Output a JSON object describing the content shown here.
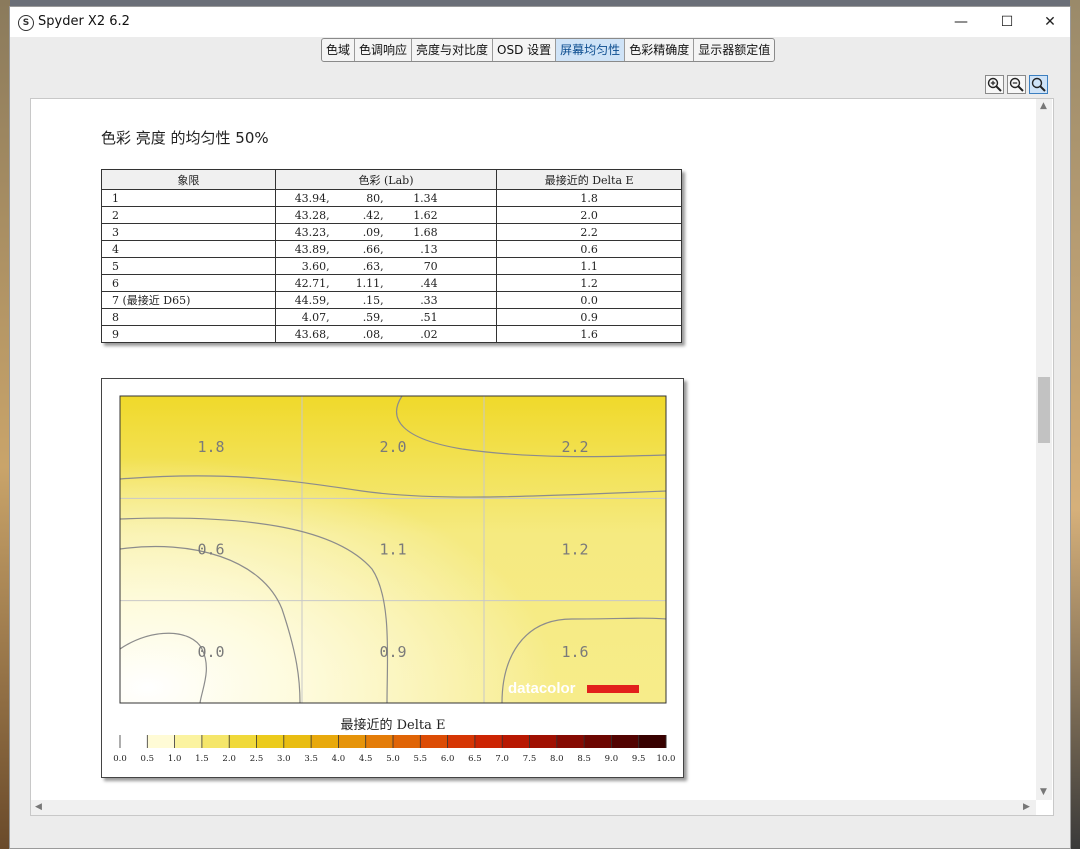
{
  "window": {
    "title": "Spyder X2 6.2",
    "controls": [
      "—",
      "☐",
      "✕"
    ]
  },
  "tabs": [
    {
      "label": "色域"
    },
    {
      "label": "色调响应"
    },
    {
      "label": "亮度与对比度"
    },
    {
      "label": "OSD 设置"
    },
    {
      "label": "屏幕均匀性",
      "active": true
    },
    {
      "label": "色彩精确度"
    },
    {
      "label": "显示器额定值"
    }
  ],
  "zoom_tools": [
    "zoom-in-icon",
    "zoom-out-icon",
    "zoom-fit-icon"
  ],
  "report": {
    "title": "色彩 亮度 的均匀性 50%",
    "table": {
      "headers": [
        "象限",
        "色彩 (Lab)",
        "最接近的 Delta E"
      ],
      "rows": [
        {
          "q": "1",
          "l": "43.94,",
          "a": "80,",
          "b": "1.34",
          "de": "1.8"
        },
        {
          "q": "2",
          "l": "43.28,",
          "a": ".42,",
          "b": "1.62",
          "de": "2.0"
        },
        {
          "q": "3",
          "l": "43.23,",
          "a": ".09,",
          "b": "1.68",
          "de": "2.2"
        },
        {
          "q": "4",
          "l": "43.89,",
          "a": ".66,",
          "b": ".13",
          "de": "0.6"
        },
        {
          "q": "5",
          "l": "3.60,",
          "a": ".63,",
          "b": "70",
          "de": "1.1"
        },
        {
          "q": "6",
          "l": "42.71,",
          "a": "1.11,",
          "b": ".44",
          "de": "1.2"
        },
        {
          "q": "7 (最接近 D65)",
          "l": "44.59,",
          "a": ".15,",
          "b": ".33",
          "de": "0.0"
        },
        {
          "q": "8",
          "l": "4.07,",
          "a": ".59,",
          "b": ".51",
          "de": "0.9"
        },
        {
          "q": "9",
          "l": "43.68,",
          "a": ".08,",
          "b": ".02",
          "de": "1.6"
        }
      ]
    }
  },
  "chart_data": {
    "type": "heatmap",
    "grid": {
      "rows": 3,
      "cols": 3
    },
    "values": [
      [
        1.8,
        2.0,
        2.2
      ],
      [
        0.6,
        1.1,
        1.2
      ],
      [
        0.0,
        0.9,
        1.6
      ]
    ],
    "cell_labels": [
      [
        "1.8",
        "2.0",
        "2.2"
      ],
      [
        "0.6",
        "1.1",
        "1.2"
      ],
      [
        "0.0",
        "0.9",
        "1.6"
      ]
    ],
    "watermark": "datacolor",
    "colorbar": {
      "title": "最接近的 Delta E",
      "ticks": [
        "0.0",
        "0.5",
        "1.0",
        "1.5",
        "2.0",
        "2.5",
        "3.0",
        "3.5",
        "4.0",
        "4.5",
        "5.0",
        "5.5",
        "6.0",
        "6.5",
        "7.0",
        "7.5",
        "8.0",
        "8.5",
        "9.0",
        "9.5",
        "10.0"
      ],
      "colors": [
        "#ffffff",
        "#fffbd6",
        "#fbf3a0",
        "#f5e66a",
        "#f0d93a",
        "#eccb1c",
        "#e9bd12",
        "#e8a90c",
        "#e6940a",
        "#e47c08",
        "#e06406",
        "#dc4c05",
        "#d63604",
        "#cc2403",
        "#b81802",
        "#a01002",
        "#860a02",
        "#6c0601",
        "#520301",
        "#380100"
      ],
      "range": [
        0,
        10
      ]
    },
    "colors": {
      "field_light": "#ffffff",
      "field_dark": "#f1dc2a",
      "contour": "#8c8c8c",
      "brand_red": "#e2201c"
    }
  }
}
